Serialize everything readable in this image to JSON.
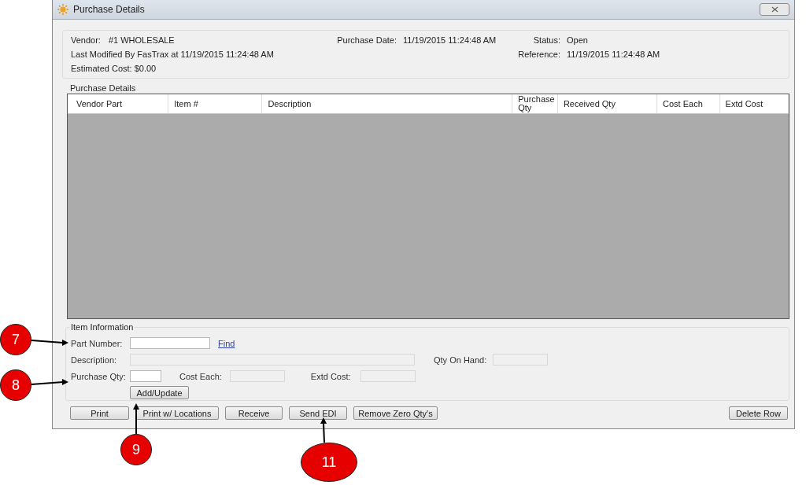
{
  "window": {
    "title": "Purchase Details"
  },
  "header": {
    "vendor_label": "Vendor:",
    "vendor": "#1 WHOLESALE",
    "purchase_date_label": "Purchase Date:",
    "purchase_date": "11/19/2015 11:24:48 AM",
    "status_label": "Status:",
    "status": "Open",
    "last_modified": "Last Modified By FasTrax at 11/19/2015 11:24:48 AM",
    "reference_label": "Reference:",
    "reference": "11/19/2015 11:24:48 AM",
    "estimated_cost": "Estimated Cost: $0.00"
  },
  "purchase_details": {
    "title": "Purchase Details",
    "columns": [
      "Vendor Part",
      "Item #",
      "Description",
      "Purchase Qty",
      "Received Qty",
      "Cost Each",
      "Extd Cost"
    ]
  },
  "item_information": {
    "title": "Item Information",
    "part_number": {
      "label": "Part Number:",
      "disabled": false
    },
    "find_link": "Find",
    "description": {
      "label": "Description:",
      "disabled": true
    },
    "qty_on_hand": {
      "label": "Qty On Hand:",
      "disabled": true
    },
    "purchase_qty": {
      "label": "Purchase Qty:",
      "disabled": false
    },
    "cost_each": {
      "label": "Cost Each:",
      "disabled": true
    },
    "extd_cost": {
      "label": "Extd Cost:",
      "disabled": true
    },
    "add_button": "Add/Update"
  },
  "buttons": [
    "Print",
    "Print w/ Locations",
    "Receive",
    "Send EDI",
    "Remove Zero Qty's",
    "Delete Row"
  ],
  "callouts": [
    "7",
    "8",
    "9",
    "11"
  ]
}
